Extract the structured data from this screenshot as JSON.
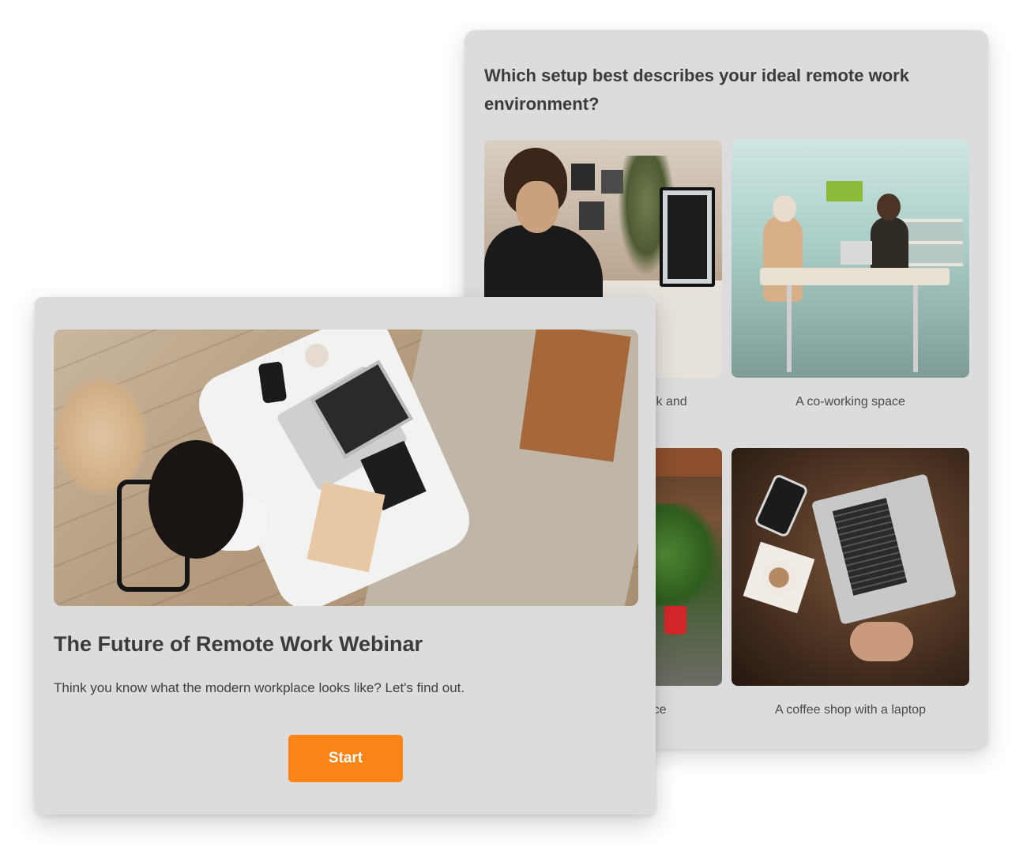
{
  "quiz": {
    "question": "Which setup best describes your ideal remote work environment?",
    "options": [
      {
        "label": "A home office with a desk and",
        "image": "home-office-photo"
      },
      {
        "label": "A co-working space",
        "image": "coworking-photo"
      },
      {
        "label": "An outdoor cafe space",
        "image": "outdoor-cafe-photo"
      },
      {
        "label": "A coffee shop with a laptop",
        "image": "coffee-shop-photo"
      }
    ]
  },
  "intro": {
    "title": "The Future of Remote Work Webinar",
    "description": "Think you know what the modern workplace looks like? Let's find out.",
    "start_label": "Start",
    "image": "hero-desk-photo"
  },
  "colors": {
    "card_background": "#dcdcdc",
    "accent": "#fb8417",
    "text": "#3b3b3b"
  }
}
